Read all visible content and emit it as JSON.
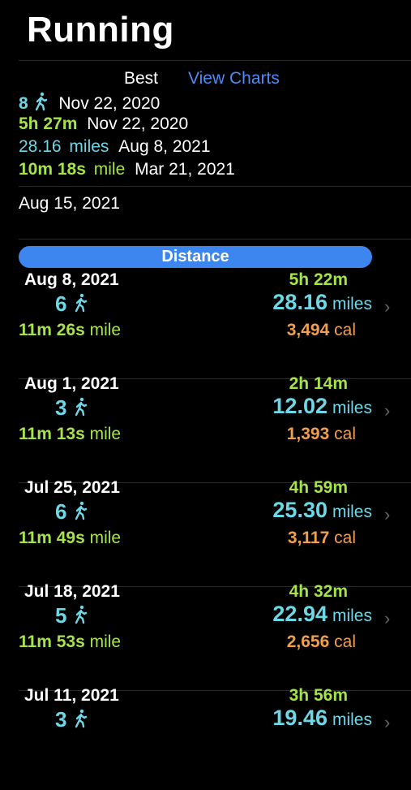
{
  "header": {
    "title": "Running"
  },
  "best": {
    "label": "Best",
    "charts_link": "View Charts",
    "rows": [
      {
        "value": "8",
        "date": "Nov 22, 2020"
      },
      {
        "value": "5h 27m",
        "date": "Nov 22, 2020"
      },
      {
        "value": "28.16",
        "unit": "miles",
        "date": "Aug 8, 2021"
      },
      {
        "value": "10m 18s",
        "unit": "mile",
        "date": "Mar 21, 2021"
      }
    ]
  },
  "current_date": "Aug 15, 2021",
  "section": {
    "label": "Distance"
  },
  "entries": [
    {
      "date": "Aug 8, 2021",
      "count": "6",
      "pace": "11m 26s",
      "pace_unit": "mile",
      "duration": "5h 22m",
      "distance": "28.16",
      "distance_unit": "miles",
      "calories": "3,494",
      "cal_unit": "cal"
    },
    {
      "date": "Aug 1, 2021",
      "count": "3",
      "pace": "11m 13s",
      "pace_unit": "mile",
      "duration": "2h 14m",
      "distance": "12.02",
      "distance_unit": "miles",
      "calories": "1,393",
      "cal_unit": "cal"
    },
    {
      "date": "Jul 25, 2021",
      "count": "6",
      "pace": "11m 49s",
      "pace_unit": "mile",
      "duration": "4h 59m",
      "distance": "25.30",
      "distance_unit": "miles",
      "calories": "3,117",
      "cal_unit": "cal"
    },
    {
      "date": "Jul 18, 2021",
      "count": "5",
      "pace": "11m 53s",
      "pace_unit": "mile",
      "duration": "4h 32m",
      "distance": "22.94",
      "distance_unit": "miles",
      "calories": "2,656",
      "cal_unit": "cal"
    },
    {
      "date": "Jul 11, 2021",
      "count": "3",
      "pace": "",
      "pace_unit": "",
      "duration": "3h 56m",
      "distance": "19.46",
      "distance_unit": "miles",
      "calories": "",
      "cal_unit": ""
    }
  ],
  "icons": {
    "walker": "walking-person-icon",
    "chevron": "chevron-right-icon"
  },
  "colors": {
    "cyan": "#6fd6e6",
    "green": "#a6e34a",
    "orange": "#f0a04b",
    "blue": "#3d86f0",
    "link": "#4a8cf7"
  }
}
